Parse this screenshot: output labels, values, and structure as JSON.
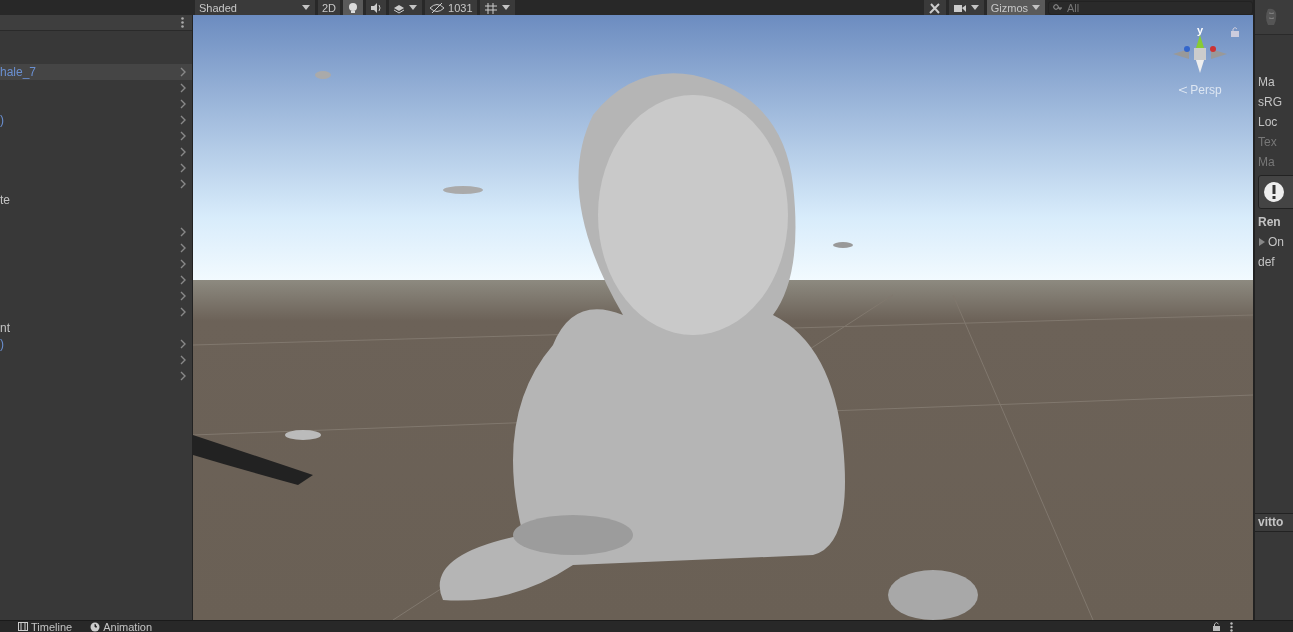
{
  "toolbar": {
    "shading_mode": "Shaded",
    "toggles": [
      {
        "kind": "mode",
        "label": "2D",
        "on": false
      },
      {
        "kind": "light",
        "on": true
      },
      {
        "kind": "audio",
        "on": false
      },
      {
        "kind": "effects",
        "on": false
      }
    ],
    "hidden_count": "1031",
    "gizmos": "Gizmos",
    "search": {
      "placeholder": "All"
    }
  },
  "hierarchy": {
    "rows": [
      {
        "text": "hale_7",
        "link": true,
        "expandable": true,
        "selected": true
      },
      {
        "expandable": true,
        "selected": false
      },
      {
        "expandable": true,
        "selected": false
      },
      {
        "text": ")",
        "link": true,
        "expandable": true,
        "selected": false
      },
      {
        "expandable": true,
        "selected": false
      },
      {
        "expandable": true,
        "selected": false
      },
      {
        "expandable": true,
        "selected": false
      },
      {
        "expandable": true,
        "selected": false
      },
      {
        "text": "te",
        "link": false,
        "expandable": false,
        "selected": false
      },
      {
        "expandable": false,
        "selected": false
      },
      {
        "expandable": true,
        "selected": false
      },
      {
        "expandable": true,
        "selected": false
      },
      {
        "expandable": true,
        "selected": false
      },
      {
        "expandable": true,
        "selected": false
      },
      {
        "expandable": true,
        "selected": false
      },
      {
        "expandable": true,
        "selected": false
      },
      {
        "text": "nt",
        "link": false,
        "expandable": false,
        "selected": false
      },
      {
        "text": ")",
        "link": true,
        "expandable": true,
        "selected": false
      },
      {
        "expandable": true,
        "selected": false
      },
      {
        "expandable": true,
        "selected": false
      }
    ]
  },
  "scene": {
    "axis_label": "y",
    "projection": "Persp"
  },
  "inspector": {
    "lines": [
      {
        "kind": "label",
        "text": "Ma",
        "disabled": false
      },
      {
        "kind": "label",
        "text": "sRG",
        "disabled": false
      },
      {
        "kind": "label",
        "text": "Loc",
        "disabled": false
      },
      {
        "kind": "label",
        "text": "Tex",
        "disabled": true
      },
      {
        "kind": "label",
        "text": "Ma",
        "disabled": true
      },
      {
        "kind": "warning"
      },
      {
        "kind": "header",
        "text": "Ren"
      },
      {
        "kind": "foldout",
        "text": "On",
        "expanded": false
      },
      {
        "kind": "label",
        "text": "def",
        "disabled": false
      }
    ],
    "tab": "vitto"
  },
  "bottom_tabs": [
    {
      "label": "Timeline",
      "kind": "timeline",
      "selected": false
    },
    {
      "label": "Animation",
      "kind": "animation",
      "selected": false
    }
  ]
}
